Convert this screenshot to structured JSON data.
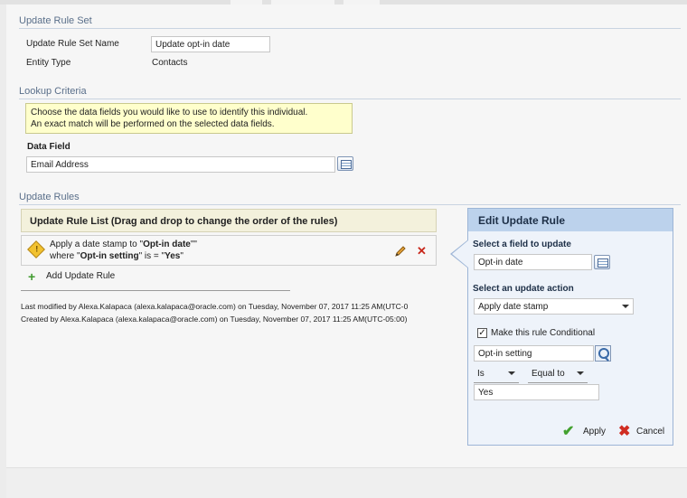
{
  "header": {
    "title": "Update Rule Set"
  },
  "rule_set": {
    "name_label": "Update Rule Set Name",
    "name_value": "Update opt-in date",
    "entity_label": "Entity Type",
    "entity_value": "Contacts"
  },
  "lookup": {
    "title": "Lookup Criteria",
    "hint_line1": "Choose the data fields you would like to use to identify this individual.",
    "hint_line2": "An exact match will be performed on the selected data fields.",
    "data_field_label": "Data Field",
    "data_field_value": "Email Address"
  },
  "rules": {
    "title": "Update Rules",
    "list_header": "Update Rule List (Drag and drop to change the order of the rules)",
    "item": {
      "line1_prefix": "Apply a date stamp to \"",
      "line1_bold": "Opt-in date",
      "line1_suffix": "\"\"",
      "line2_prefix": "where \"",
      "line2_bold": "Opt-in setting",
      "line2_mid": "\" is = \"",
      "line2_bold2": "Yes",
      "line2_suffix": "\""
    },
    "add_label": "Add Update Rule"
  },
  "meta": {
    "modified": "Last modified by Alexa.Kalapaca (alexa.kalapaca@oracle.com) on Tuesday, November 07, 2017 11:25 AM(UTC-0",
    "created": "Created by Alexa.Kalapaca (alexa.kalapaca@oracle.com) on Tuesday, November 07, 2017 11:25 AM(UTC-05:00)"
  },
  "edit_panel": {
    "title": "Edit Update Rule",
    "field_label": "Select a field to update",
    "field_value": "Opt-in date",
    "action_label": "Select an update action",
    "action_value": "Apply date stamp",
    "conditional_label": "Make this rule Conditional",
    "condition_field": "Opt-in setting",
    "operator": "Is",
    "comparison": "Equal to",
    "condition_value": "Yes",
    "apply_label": "Apply",
    "cancel_label": "Cancel"
  },
  "icons": {
    "picker": "field-picker-icon",
    "warning": "warning-icon",
    "edit": "pencil-icon",
    "delete": "delete-x-icon",
    "add": "plus-icon",
    "search": "search-icon",
    "apply": "checkmark-icon",
    "cancel": "cancel-x-icon"
  }
}
